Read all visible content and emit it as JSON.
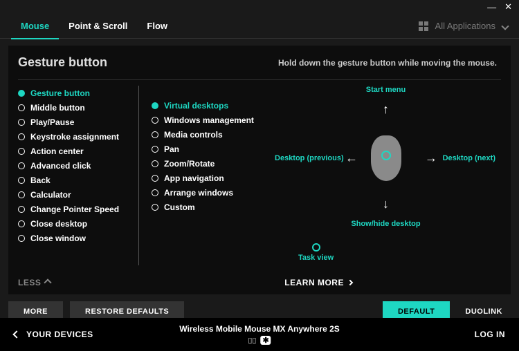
{
  "window": {
    "min": "—",
    "close": "✕"
  },
  "tabs": {
    "mouse": "Mouse",
    "point_scroll": "Point & Scroll",
    "flow": "Flow",
    "all_apps": "All Applications"
  },
  "panel": {
    "title": "Gesture button",
    "hint": "Hold down the gesture button while moving the mouse.",
    "less": "LESS",
    "learn_more": "LEARN MORE"
  },
  "col1": [
    "Gesture button",
    "Middle button",
    "Play/Pause",
    "Keystroke assignment",
    "Action center",
    "Advanced click",
    "Back",
    "Calculator",
    "Change Pointer Speed",
    "Close desktop",
    "Close window"
  ],
  "col2": [
    "Virtual desktops",
    "Windows management",
    "Media controls",
    "Pan",
    "Zoom/Rotate",
    "App navigation",
    "Arrange windows",
    "Custom"
  ],
  "gestures": {
    "up": "Start menu",
    "down": "Show/hide desktop",
    "left": "Desktop (previous)",
    "right": "Desktop (next)",
    "click": "Task view"
  },
  "buttons": {
    "more": "MORE",
    "restore": "RESTORE DEFAULTS",
    "default": "DEFAULT",
    "duolink": "DUOLINK"
  },
  "footer": {
    "your_devices": "YOUR DEVICES",
    "device": "Wireless Mobile Mouse MX Anywhere 2S",
    "login": "LOG IN"
  }
}
